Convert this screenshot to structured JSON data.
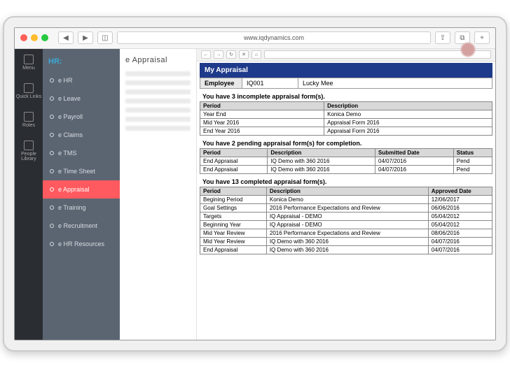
{
  "browser": {
    "url": "www.iqdynamics.com"
  },
  "leftbar": {
    "items": [
      {
        "label": "Menu"
      },
      {
        "label": "Quick Links"
      },
      {
        "label": "Roles"
      },
      {
        "label": "People Library"
      }
    ]
  },
  "logo": "HR:",
  "sidebar": {
    "items": [
      {
        "label": "e HR"
      },
      {
        "label": "e Leave"
      },
      {
        "label": "e Payroll"
      },
      {
        "label": "e Claims"
      },
      {
        "label": "e TMS"
      },
      {
        "label": "e Time Sheet"
      },
      {
        "label": "e Appraisal"
      },
      {
        "label": "e Training"
      },
      {
        "label": "e Recruitment"
      },
      {
        "label": "e HR Resources"
      }
    ],
    "active_index": 6
  },
  "subpanel": {
    "title": "e Appraisal"
  },
  "appraisal": {
    "header": "My Appraisal",
    "employee_label": "Employee",
    "employee_id": "IQ001",
    "employee_name": "Lucky Mee",
    "incomplete": {
      "title": "You have 3 incomplete appraisal form(s).",
      "cols": [
        "Period",
        "Description"
      ],
      "rows": [
        {
          "period": "Year End",
          "desc": "Konica Demo"
        },
        {
          "period": "Mid Year 2016",
          "desc": "Appraisal Form 2016"
        },
        {
          "period": "End Year 2016",
          "desc": "Appraisal Form 2016"
        }
      ]
    },
    "pending": {
      "title": "You have 2 pending appraisal form(s) for completion.",
      "cols": [
        "Period",
        "Description",
        "Submitted Date",
        "Status"
      ],
      "rows": [
        {
          "period": "End Appraisal",
          "desc": "IQ Demo with 360 2016",
          "submitted": "04/07/2016",
          "status": "Pend"
        },
        {
          "period": "End Appraisal",
          "desc": "IQ Demo with 360 2016",
          "submitted": "04/07/2016",
          "status": "Pend"
        }
      ]
    },
    "completed": {
      "title": "You have 13 completed appraisal form(s).",
      "cols": [
        "Period",
        "Description",
        "Approved Date"
      ],
      "rows": [
        {
          "period": "Begining Period",
          "desc": "Konica Demo",
          "approved": "12/06/2017"
        },
        {
          "period": "Goal Settings",
          "desc": "2016 Performance Expectations and Review",
          "approved": "06/06/2016"
        },
        {
          "period": "Targets",
          "desc": "IQ Appraisal - DEMO",
          "approved": "05/04/2012"
        },
        {
          "period": "Beginning Year",
          "desc": "IQ Appraisal - DEMO",
          "approved": "05/04/2012"
        },
        {
          "period": "Mid Year Review",
          "desc": "2016 Performance Expectations and Review",
          "approved": "08/06/2016"
        },
        {
          "period": "Mid Year Review",
          "desc": "IQ Demo with 360 2016",
          "approved": "04/07/2016"
        },
        {
          "period": "End Appraisal",
          "desc": "IQ Demo with 360 2016",
          "approved": "04/07/2016"
        }
      ]
    }
  }
}
